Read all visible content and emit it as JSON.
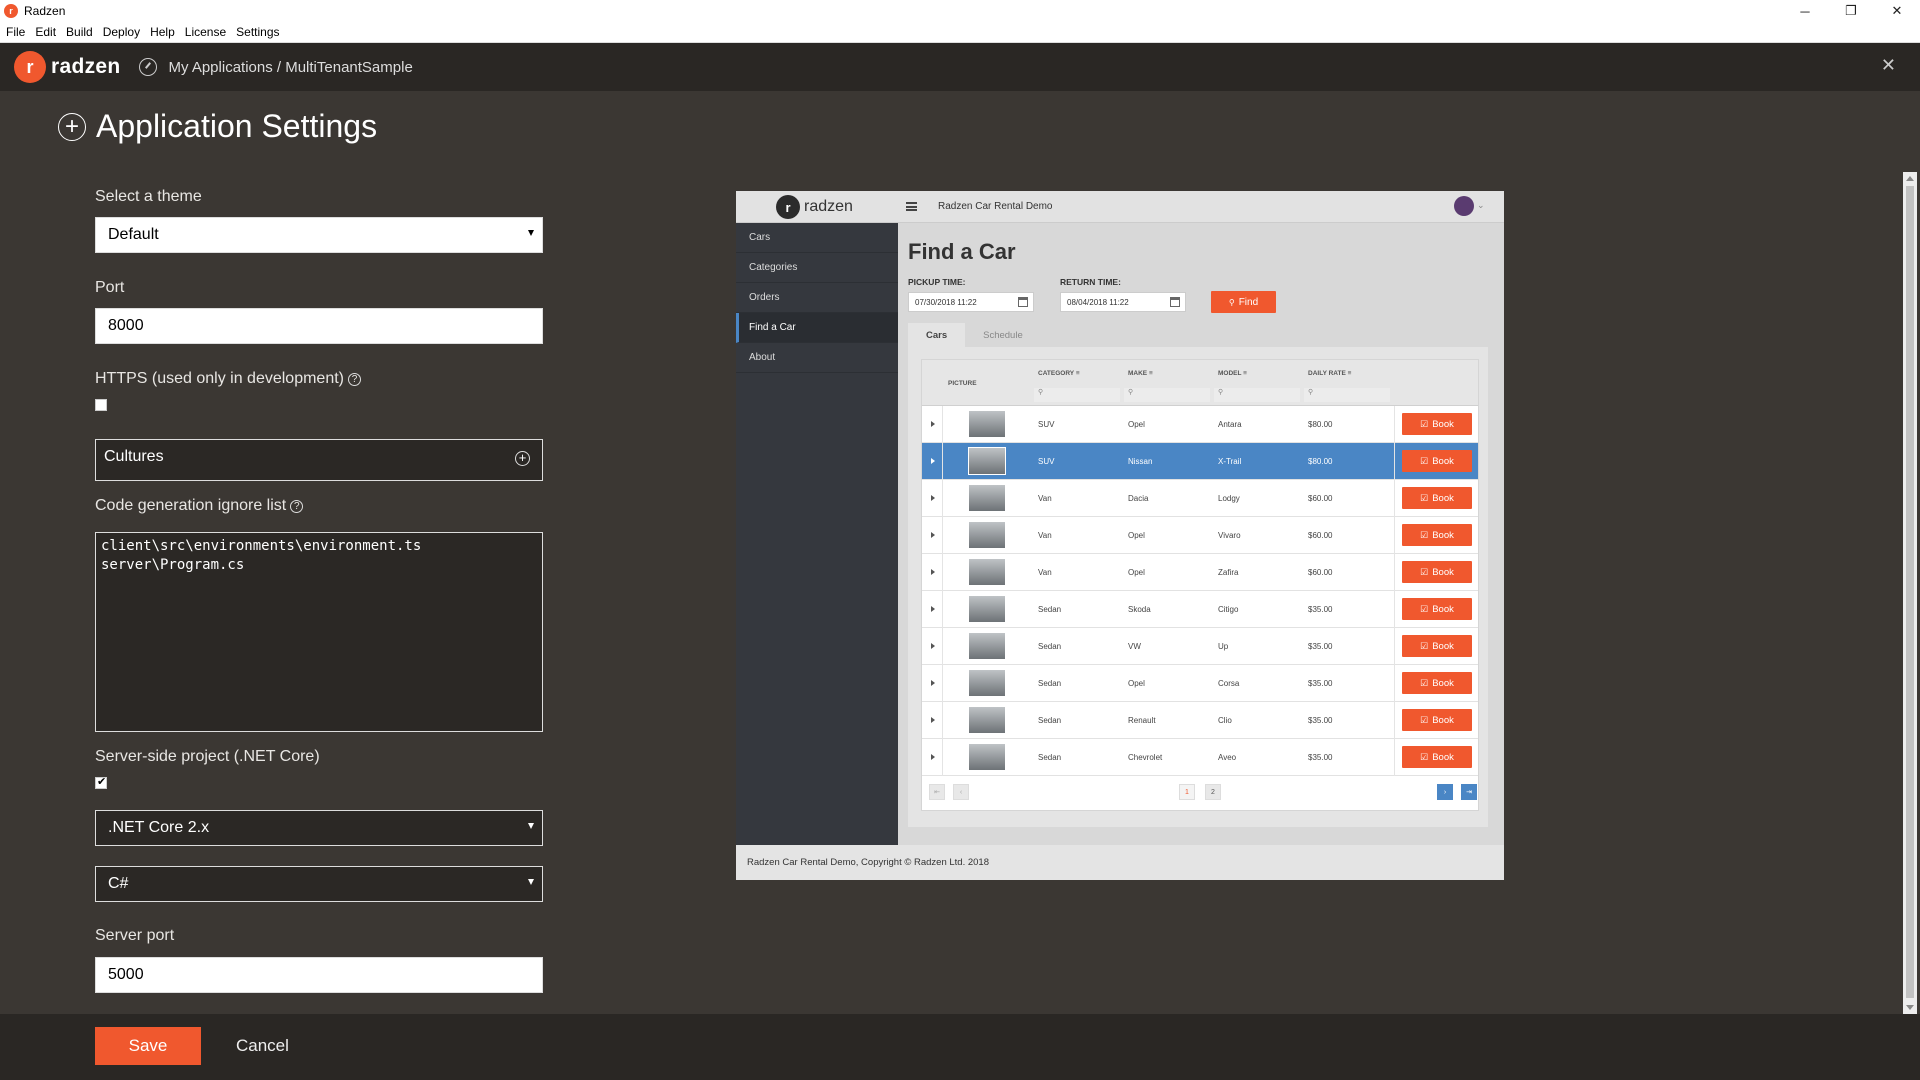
{
  "window": {
    "title": "Radzen",
    "icon_letter": "r"
  },
  "menu": [
    "File",
    "Edit",
    "Build",
    "Deploy",
    "Help",
    "License",
    "Settings"
  ],
  "header": {
    "logo_text": "radzen",
    "breadcrumb": "My Applications / MultiTenantSample"
  },
  "page": {
    "title": "Application Settings"
  },
  "form": {
    "theme_label": "Select a theme",
    "theme_value": "Default",
    "port_label": "Port",
    "port_value": "8000",
    "https_label": "HTTPS (used only in development)",
    "https_checked": false,
    "cultures_label": "Cultures",
    "ignore_label": "Code generation ignore list",
    "ignore_value": "client\\src\\environments\\environment.ts\nserver\\Program.cs",
    "server_project_label": "Server-side project (.NET Core)",
    "server_project_checked": true,
    "framework_value": ".NET Core 2.x",
    "language_value": "C#",
    "server_port_label": "Server port",
    "server_port_value": "5000",
    "save_label": "Save",
    "cancel_label": "Cancel"
  },
  "preview": {
    "logo_text": "radzen",
    "app_title": "Radzen Car Rental Demo",
    "nav": [
      "Cars",
      "Categories",
      "Orders",
      "Find a Car",
      "About"
    ],
    "active_nav": "Find a Car",
    "heading": "Find a Car",
    "pickup_label": "PICKUP TIME:",
    "pickup_value": "07/30/2018 11:22",
    "return_label": "RETURN TIME:",
    "return_value": "08/04/2018 11:22",
    "find_label": "Find",
    "tabs": [
      "Cars",
      "Schedule"
    ],
    "columns": {
      "picture": "PICTURE",
      "category": "CATEGORY",
      "make": "MAKE",
      "model": "MODEL",
      "rate": "DAILY RATE"
    },
    "book_label": "Book",
    "rows": [
      {
        "category": "SUV",
        "make": "Opel",
        "model": "Antara",
        "rate": "$80.00"
      },
      {
        "category": "SUV",
        "make": "Nissan",
        "model": "X-Trail",
        "rate": "$80.00"
      },
      {
        "category": "Van",
        "make": "Dacia",
        "model": "Lodgy",
        "rate": "$60.00"
      },
      {
        "category": "Van",
        "make": "Opel",
        "model": "Vivaro",
        "rate": "$60.00"
      },
      {
        "category": "Van",
        "make": "Opel",
        "model": "Zafira",
        "rate": "$60.00"
      },
      {
        "category": "Sedan",
        "make": "Skoda",
        "model": "Citigo",
        "rate": "$35.00"
      },
      {
        "category": "Sedan",
        "make": "VW",
        "model": "Up",
        "rate": "$35.00"
      },
      {
        "category": "Sedan",
        "make": "Opel",
        "model": "Corsa",
        "rate": "$35.00"
      },
      {
        "category": "Sedan",
        "make": "Renault",
        "model": "Clio",
        "rate": "$35.00"
      },
      {
        "category": "Sedan",
        "make": "Chevrolet",
        "model": "Aveo",
        "rate": "$35.00"
      }
    ],
    "selected_row": 1,
    "pages": [
      "1",
      "2"
    ],
    "footer": "Radzen Car Rental Demo, Copyright © Radzen Ltd. 2018"
  },
  "colors": {
    "accent": "#f0582e",
    "selection": "#4a86c5",
    "background": "#3b3733",
    "header": "#2a2724"
  }
}
